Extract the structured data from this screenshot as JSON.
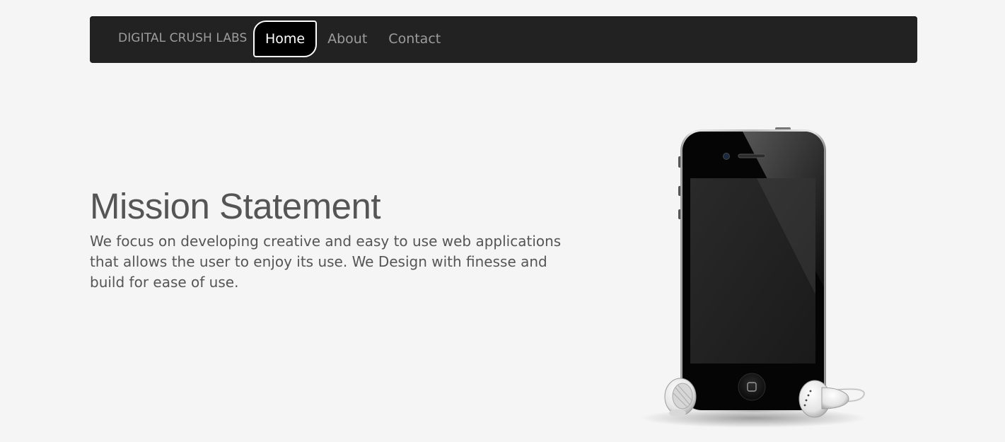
{
  "navbar": {
    "brand": "DIGITAL CRUSH LABS",
    "items": [
      {
        "label": "Home",
        "active": true
      },
      {
        "label": "About",
        "active": false
      },
      {
        "label": "Contact",
        "active": false
      }
    ]
  },
  "hero": {
    "title": "Mission Statement",
    "body": "We focus on developing creative and easy to use web applications that allows the user to enjoy its use. We Design with finesse and build for ease of use."
  },
  "illustration": {
    "icon": "smartphone-with-earphones-icon"
  },
  "colors": {
    "background": "#f5f5f5",
    "navbar": "#222222",
    "nav_text": "#9d9d9d",
    "active_text": "#ffffff",
    "body_text": "#555555"
  }
}
